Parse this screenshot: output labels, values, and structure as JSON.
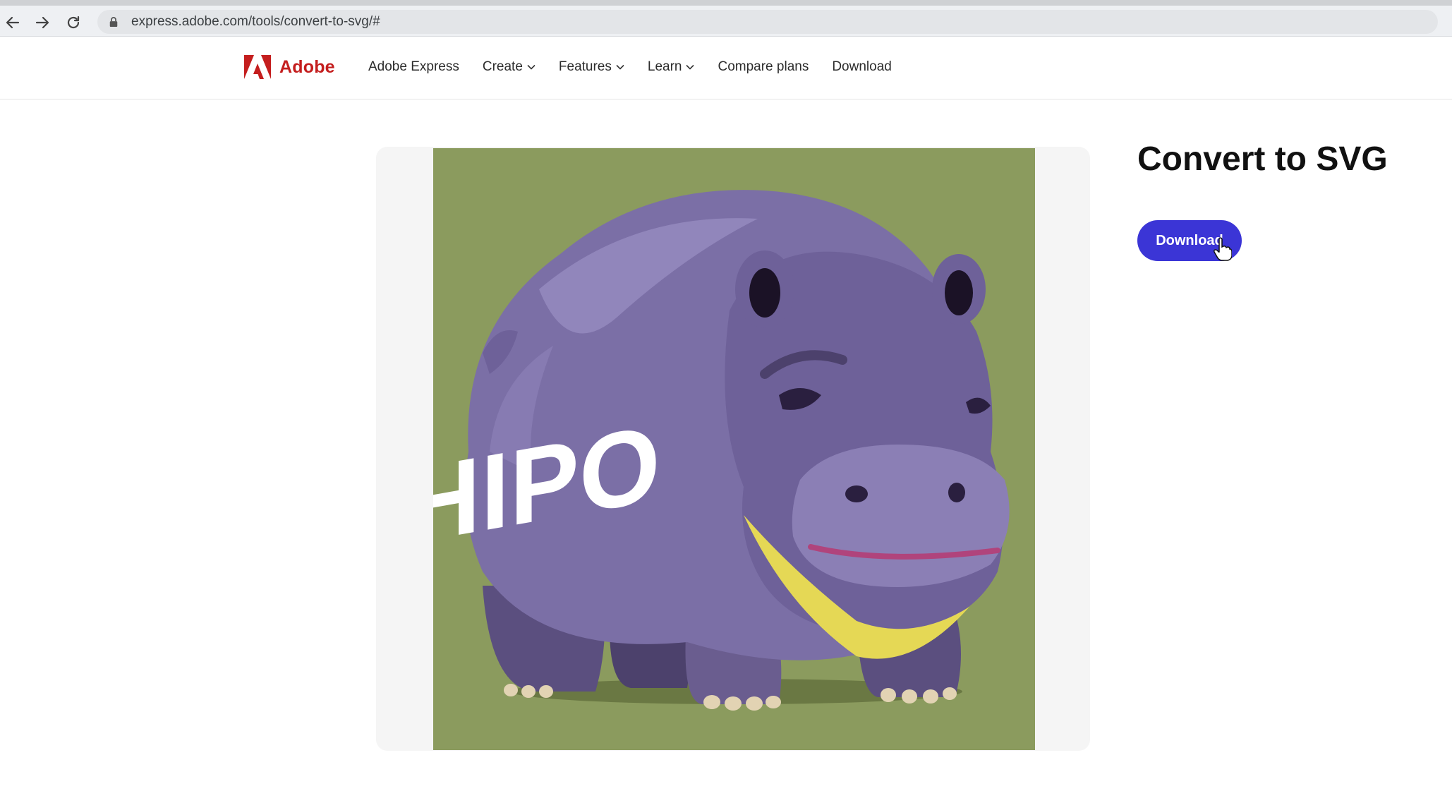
{
  "browser": {
    "url": "express.adobe.com/tools/convert-to-svg/#",
    "icons": [
      "back-arrow-icon",
      "forward-arrow-icon",
      "reload-icon",
      "lock-icon"
    ]
  },
  "header": {
    "brand": "Adobe",
    "brand_color": "#c41e1e",
    "nav": [
      {
        "label": "Adobe Express",
        "has_dropdown": false
      },
      {
        "label": "Create",
        "has_dropdown": true
      },
      {
        "label": "Features",
        "has_dropdown": true
      },
      {
        "label": "Learn",
        "has_dropdown": true
      },
      {
        "label": "Compare plans",
        "has_dropdown": false
      },
      {
        "label": "Download",
        "has_dropdown": false
      }
    ]
  },
  "main": {
    "title": "Convert to SVG",
    "download_label": "Download",
    "accent_color": "#3b35d6",
    "artwork": {
      "text": "HIPO",
      "background_color": "#8b9b5e"
    }
  }
}
